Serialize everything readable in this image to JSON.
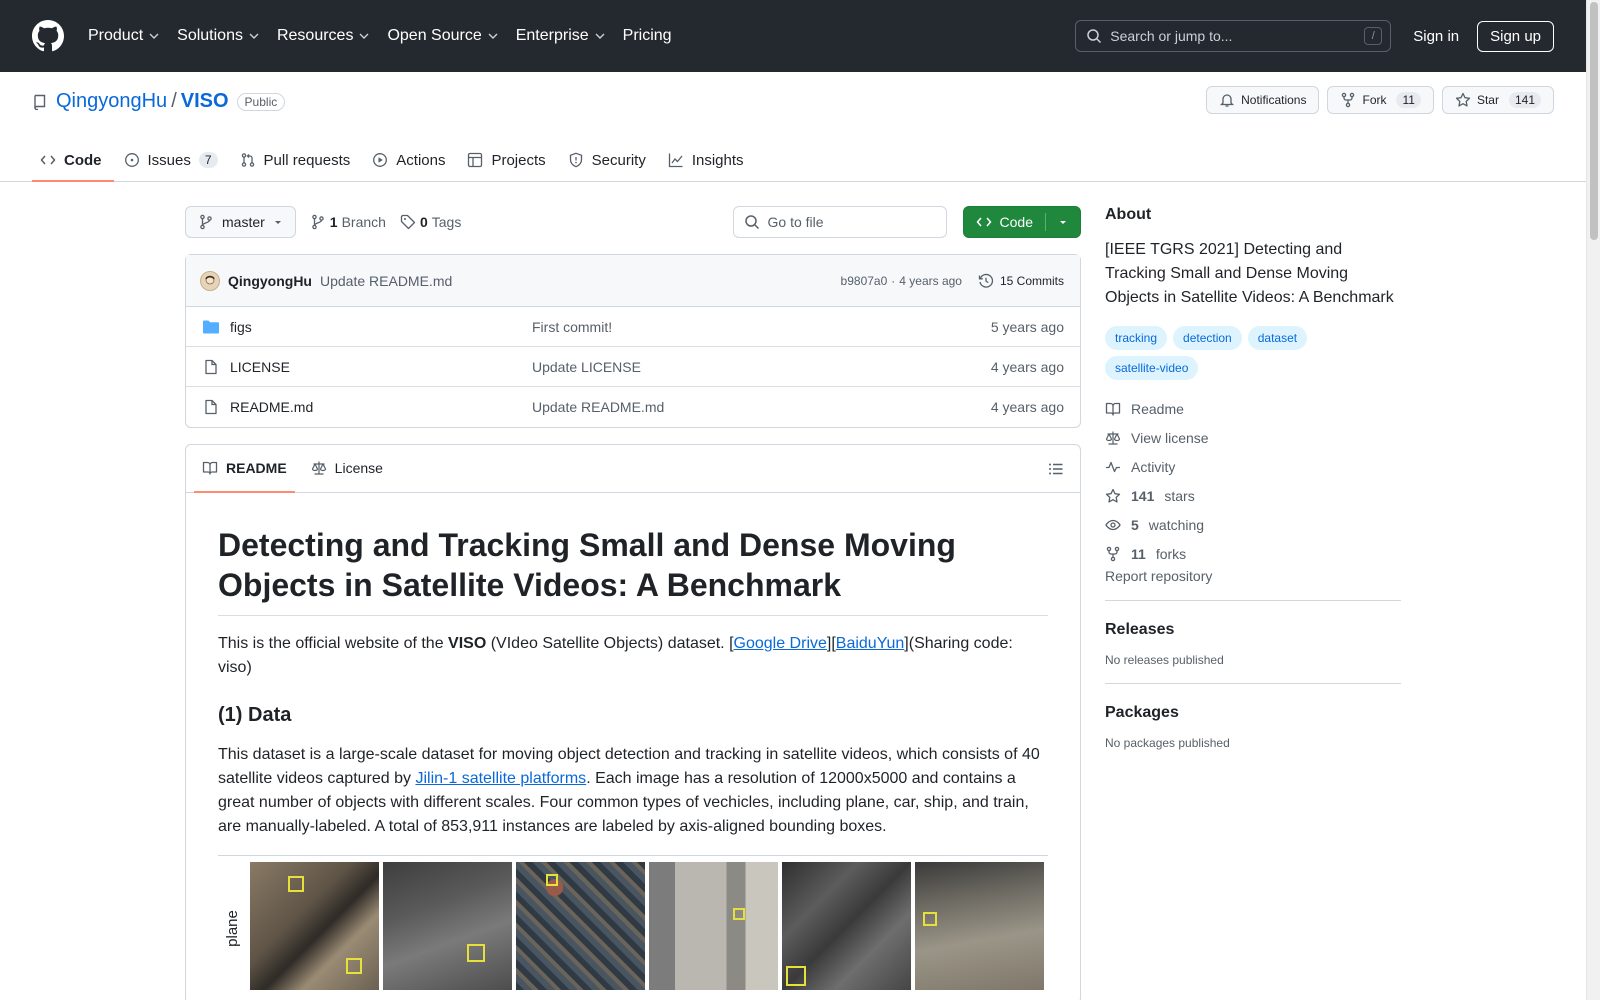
{
  "header": {
    "nav": [
      {
        "label": "Product",
        "dropdown": true
      },
      {
        "label": "Solutions",
        "dropdown": true
      },
      {
        "label": "Resources",
        "dropdown": true
      },
      {
        "label": "Open Source",
        "dropdown": true
      },
      {
        "label": "Enterprise",
        "dropdown": true
      },
      {
        "label": "Pricing",
        "dropdown": false
      }
    ],
    "search_placeholder": "Search or jump to...",
    "search_shortcut": "/",
    "sign_in": "Sign in",
    "sign_up": "Sign up"
  },
  "repo": {
    "owner": "QingyongHu",
    "separator": "/",
    "name": "VISO",
    "visibility": "Public",
    "notifications_label": "Notifications",
    "fork_label": "Fork",
    "fork_count": "11",
    "star_label": "Star",
    "star_count": "141",
    "tabs": [
      {
        "label": "Code",
        "counter": ""
      },
      {
        "label": "Issues",
        "counter": "7"
      },
      {
        "label": "Pull requests",
        "counter": ""
      },
      {
        "label": "Actions",
        "counter": ""
      },
      {
        "label": "Projects",
        "counter": ""
      },
      {
        "label": "Security",
        "counter": ""
      },
      {
        "label": "Insights",
        "counter": ""
      }
    ]
  },
  "filebar": {
    "branch": "master",
    "branch_count": "1",
    "branch_label": "Branch",
    "tag_count": "0",
    "tag_label": "Tags",
    "goto_placeholder": "Go to file",
    "code_label": "Code"
  },
  "commit": {
    "author": "QingyongHu",
    "message": "Update README.md",
    "hash": "b9807a0",
    "dot": "·",
    "age": "4 years ago",
    "commits_label": "15 Commits"
  },
  "files": [
    {
      "name": "figs",
      "type": "folder",
      "message": "First commit!",
      "date": "5 years ago"
    },
    {
      "name": "LICENSE",
      "type": "file",
      "message": "Update LICENSE",
      "date": "4 years ago"
    },
    {
      "name": "README.md",
      "type": "file",
      "message": "Update README.md",
      "date": "4 years ago"
    }
  ],
  "readme": {
    "tabs": {
      "readme": "README",
      "license": "License"
    },
    "title": "Detecting and Tracking Small and Dense Moving Objects in Satellite Videos: A Benchmark",
    "intro_pre": "This is the official website of the ",
    "intro_bold": "VISO",
    "intro_mid": " (VIdeo Satellite Objects) dataset. [",
    "link_gdrive": "Google Drive",
    "intro_mid2": "][",
    "link_baidu": "BaiduYun",
    "intro_post": "](Sharing code: viso)",
    "section1": "(1) Data",
    "data_pre": "This dataset is a large-scale dataset for moving object detection and tracking in satellite videos, which consists of 40 satellite videos captured by ",
    "link_jilin": "Jilin-1 satellite platforms",
    "data_post": ". Each image has a resolution of 12000x5000 and contains a great number of objects with different scales. Four common types of vechicles, including plane, car, ship, and train, are manually-labeled. A total of 853,911 instances are labeled by axis-aligned bounding boxes.",
    "figure_label": "plane"
  },
  "about": {
    "heading": "About",
    "description": "[IEEE TGRS 2021] Detecting and Tracking Small and Dense Moving Objects in Satellite Videos: A Benchmark",
    "topics": [
      "tracking",
      "detection",
      "dataset",
      "satellite-video"
    ],
    "readme": "Readme",
    "license": "View license",
    "activity": "Activity",
    "stars_count": "141",
    "stars_label": "stars",
    "watching_count": "5",
    "watching_label": "watching",
    "forks_count": "11",
    "forks_label": "forks",
    "report": "Report repository"
  },
  "releases": {
    "heading": "Releases",
    "empty": "No releases published"
  },
  "packages": {
    "heading": "Packages",
    "empty": "No packages published"
  },
  "colors": {
    "header_bg": "#24292f",
    "accent": "#0969da",
    "primary_button": "#1f883d",
    "tab_underline": "#fd8c73"
  }
}
